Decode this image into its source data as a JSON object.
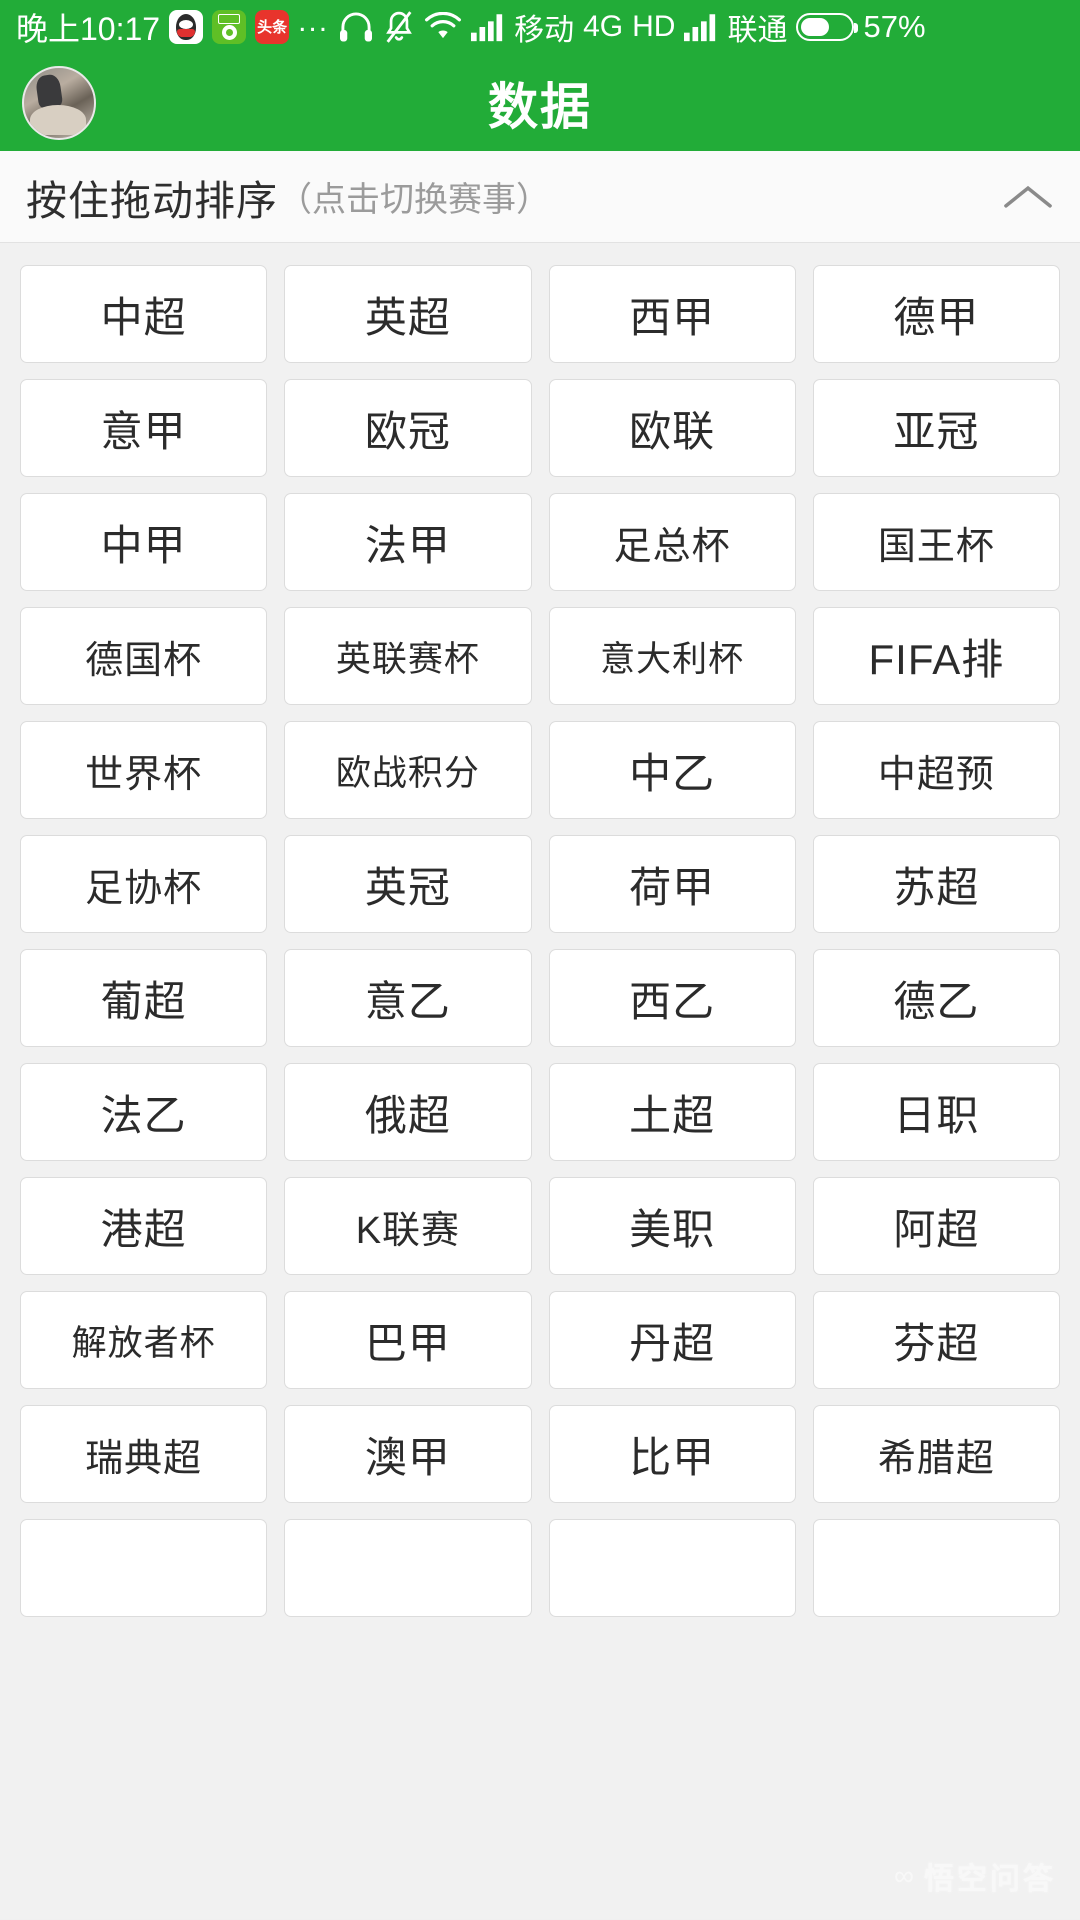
{
  "status_bar": {
    "time": "晚上10:17",
    "app_icons": [
      "qq-icon",
      "soccer-app-icon",
      "toutiao-icon"
    ],
    "toutiao_label": "头条",
    "overflow_dots": "...",
    "icons": [
      "headset-icon",
      "silent-bell-icon",
      "wifi-icon",
      "signal-icon"
    ],
    "carrier_1": "移动",
    "network_type": "4G",
    "hd_label": "HD",
    "carrier_2": "联通",
    "battery_percent": "57%",
    "battery_level": 57
  },
  "header": {
    "title": "数据",
    "avatar": "user-avatar",
    "bg_color": "#22ac38"
  },
  "sort_bar": {
    "main_text": "按住拖动排序",
    "sub_text": "（点击切换赛事）",
    "collapse_icon": "chevron-up-icon"
  },
  "leagues": [
    "中超",
    "英超",
    "西甲",
    "德甲",
    "意甲",
    "欧冠",
    "欧联",
    "亚冠",
    "中甲",
    "法甲",
    "足总杯",
    "国王杯",
    "德国杯",
    "英联赛杯",
    "意大利杯",
    "FIFA排",
    "世界杯",
    "欧战积分",
    "中乙",
    "中超预",
    "足协杯",
    "英冠",
    "荷甲",
    "苏超",
    "葡超",
    "意乙",
    "西乙",
    "德乙",
    "法乙",
    "俄超",
    "土超",
    "日职",
    "港超",
    "K联赛",
    "美职",
    "阿超",
    "解放者杯",
    "巴甲",
    "丹超",
    "芬超",
    "瑞典超",
    "澳甲",
    "比甲",
    "希腊超",
    "",
    "",
    "",
    ""
  ],
  "watermark": {
    "text": "悟空问答",
    "glyph": "∞"
  },
  "theme": {
    "brand_green": "#22ac38",
    "page_bg": "#f1f1f1",
    "cell_bg": "#ffffff",
    "cell_border": "#dcdcdc",
    "text_primary": "#2b2b2b",
    "text_muted": "#9b9b9b"
  }
}
